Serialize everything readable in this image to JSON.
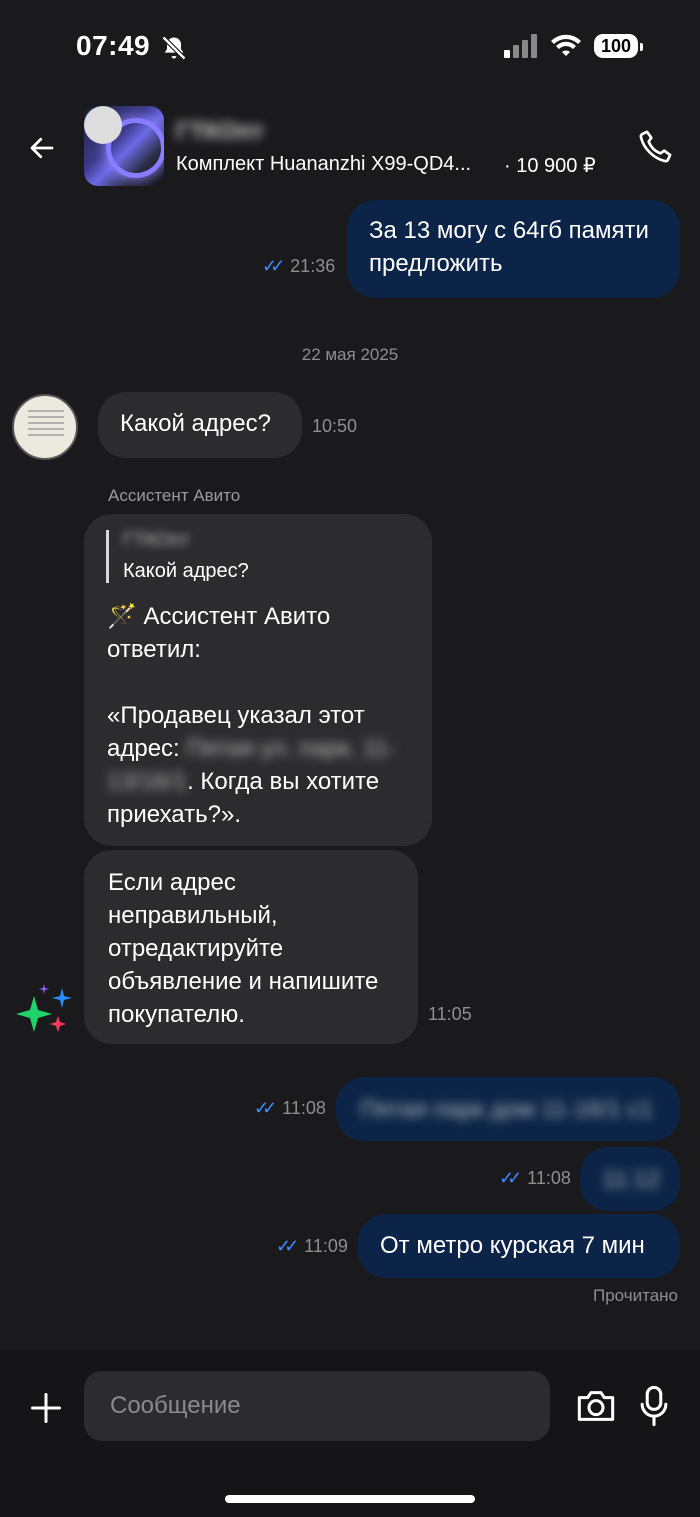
{
  "status_bar": {
    "time": "07:49",
    "battery": "100"
  },
  "header": {
    "seller_name": "ГТКОпт",
    "listing_title": "Комплект Huananzhi X99-QD4...",
    "listing_price": "· 10 900 ₽"
  },
  "messages": {
    "m1": {
      "text": "За 13 могу с 64гб памяти предложить",
      "time": "21:36"
    },
    "date_separator": "22 мая 2025",
    "m2": {
      "text": "Какой адрес?",
      "time": "10:50"
    },
    "assistant_label": "Ассистент Авито",
    "m3": {
      "quote_name": "ГТКОпт",
      "quote_text": "Какой адрес?",
      "intro": "🪄 Ассистент Авито ответил:",
      "body_start": "«Продавец указал этот адрес: ",
      "address_blurred": "Пятая ул. парк, 11-13/16/1",
      "body_end": ". Когда вы хотите приехать?»."
    },
    "m4": {
      "text": "Если адрес неправильный, отредактируйте объявление и напишите покупателю.",
      "time": "11:05"
    },
    "m5": {
      "text": "Пятая парк дом 11-16/1 с1",
      "time": "11:08"
    },
    "m6": {
      "text": "11:12",
      "time": "11:08"
    },
    "m7": {
      "text": "От метро курская 7 мин",
      "time": "11:09"
    },
    "read_status": "Прочитано"
  },
  "composer": {
    "placeholder": "Сообщение"
  },
  "colors": {
    "outgoing_bubble": "#0b2447",
    "incoming_bubble": "#2c2c2e",
    "check_marks": "#3d8bff",
    "background": "#1a1a1c"
  }
}
